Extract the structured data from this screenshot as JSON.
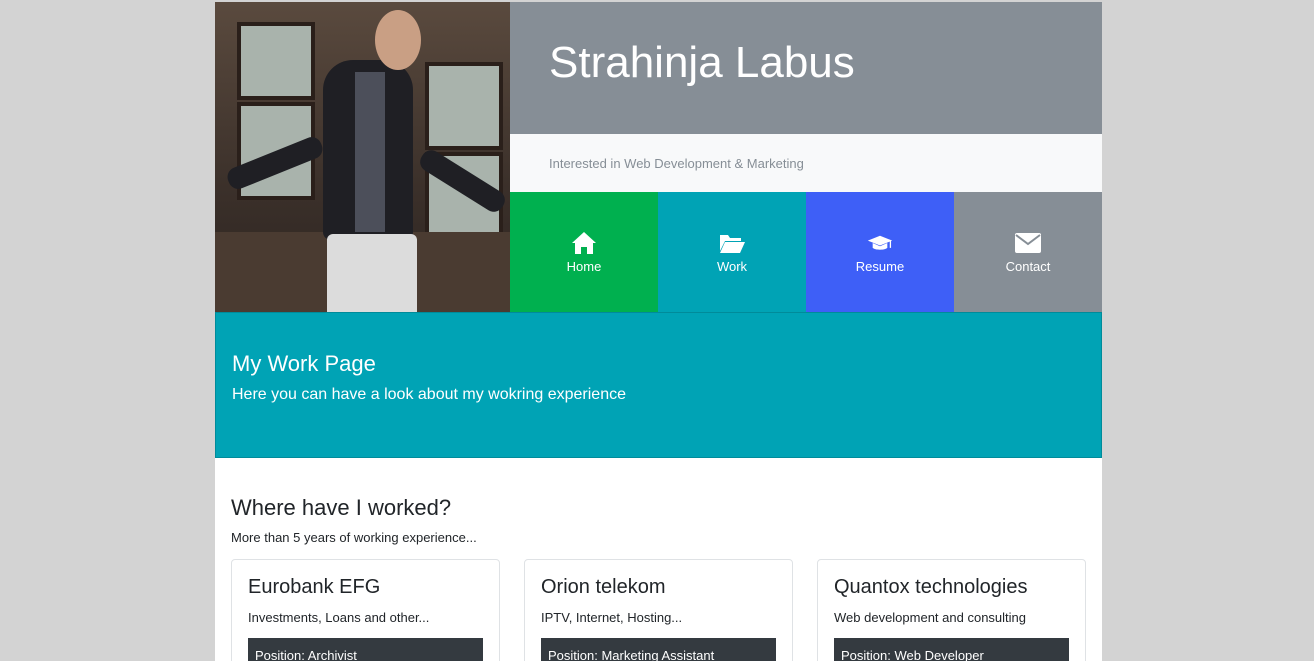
{
  "header": {
    "name": "Strahinja Labus",
    "tagline": "Interested in Web Development & Marketing"
  },
  "nav": [
    {
      "label": "Home",
      "icon": "home-icon",
      "color": "#00b04f"
    },
    {
      "label": "Work",
      "icon": "folder-open-icon",
      "color": "#00a3b5"
    },
    {
      "label": "Resume",
      "icon": "graduation-cap-icon",
      "color": "#3e5ff7"
    },
    {
      "label": "Contact",
      "icon": "envelope-icon",
      "color": "#868e96"
    }
  ],
  "jumbotron": {
    "title": "My Work Page",
    "text": "Here you can have a look about my wokring experience"
  },
  "work": {
    "title": "Where have I worked?",
    "subtitle": "More than 5 years of working experience...",
    "cards": [
      {
        "company": "Eurobank EFG",
        "description": "Investments, Loans and other...",
        "position": "Position: Archivist"
      },
      {
        "company": "Orion telekom",
        "description": "IPTV, Internet, Hosting...",
        "position": "Position: Marketing Assistant"
      },
      {
        "company": "Quantox technologies",
        "description": "Web development and consulting",
        "position": "Position: Web Developer"
      }
    ]
  }
}
